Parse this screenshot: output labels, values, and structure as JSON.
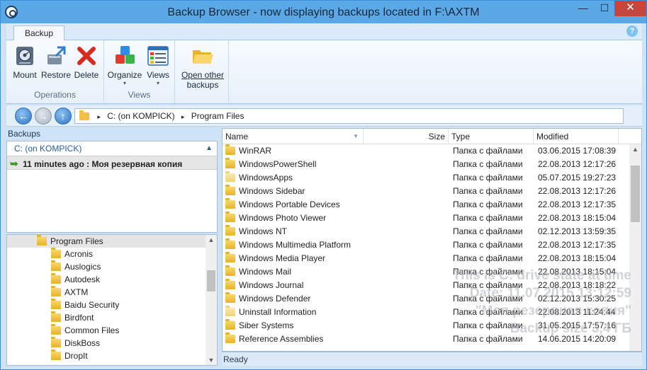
{
  "window": {
    "title": "Backup Browser - now displaying backups located in F:\\AXTM",
    "minimize_glyph": "—",
    "maximize_glyph": "☐",
    "close_glyph": "✕"
  },
  "ribbon": {
    "tab": "Backup",
    "help_glyph": "?",
    "operations": {
      "label": "Operations",
      "buttons": [
        {
          "label": "Mount",
          "icon": "mount-disk-icon"
        },
        {
          "label": "Restore",
          "icon": "restore-icon"
        },
        {
          "label": "Delete",
          "icon": "delete-x-icon"
        }
      ]
    },
    "views": {
      "label": "Views",
      "buttons": [
        {
          "label": "Organize",
          "icon": "organize-cubes-icon"
        },
        {
          "label": "Views",
          "icon": "views-list-icon"
        }
      ]
    },
    "open_other": {
      "label_line1": "Open other",
      "label_line2": "backups",
      "icon": "open-folder-icon"
    }
  },
  "address": {
    "back_glyph": "←",
    "forward_glyph": "→",
    "up_glyph": "↑",
    "separator": "▸",
    "path": [
      "C: (on KOMPICK)",
      "Program Files"
    ]
  },
  "backups": {
    "header": "Backups",
    "drive": "C: (on KOMPICK)",
    "collapse_glyph": "▲",
    "item_icon": "➥",
    "item": "11 minutes ago : Моя резервная копия"
  },
  "tree": {
    "root": "Program Files",
    "scroll_up_glyph": "▲",
    "scroll_down_glyph": "▼",
    "children": [
      "Acronis",
      "Auslogics",
      "Autodesk",
      "AXTM",
      "Baidu Security",
      "Birdfont",
      "Common Files",
      "DiskBoss",
      "DropIt"
    ]
  },
  "list": {
    "columns": {
      "name": "Name",
      "size": "Size",
      "type": "Type",
      "modified": "Modified"
    },
    "sort_glyph": "▼",
    "scroll_up_glyph": "▲",
    "rows": [
      {
        "name": "WinRAR",
        "type": "Папка с файлами",
        "modified": "03.06.2015 17:08:39",
        "pale": false
      },
      {
        "name": "WindowsPowerShell",
        "type": "Папка с файлами",
        "modified": "22.08.2013 12:17:26",
        "pale": false
      },
      {
        "name": "WindowsApps",
        "type": "Папка с файлами",
        "modified": "05.07.2015 19:27:23",
        "pale": true
      },
      {
        "name": "Windows Sidebar",
        "type": "Папка с файлами",
        "modified": "22.08.2013 12:17:26",
        "pale": false
      },
      {
        "name": "Windows Portable Devices",
        "type": "Папка с файлами",
        "modified": "22.08.2013 12:17:35",
        "pale": false
      },
      {
        "name": "Windows Photo Viewer",
        "type": "Папка с файлами",
        "modified": "22.08.2013 18:15:04",
        "pale": false
      },
      {
        "name": "Windows NT",
        "type": "Папка с файлами",
        "modified": "02.12.2013 13:59:35",
        "pale": false
      },
      {
        "name": "Windows Multimedia Platform",
        "type": "Папка с файлами",
        "modified": "22.08.2013 12:17:35",
        "pale": false
      },
      {
        "name": "Windows Media Player",
        "type": "Папка с файлами",
        "modified": "22.08.2013 18:15:04",
        "pale": false
      },
      {
        "name": "Windows Mail",
        "type": "Папка с файлами",
        "modified": "22.08.2013 18:15:04",
        "pale": false
      },
      {
        "name": "Windows Journal",
        "type": "Папка с файлами",
        "modified": "22.08.2013 18:18:22",
        "pale": false
      },
      {
        "name": "Windows Defender",
        "type": "Папка с файлами",
        "modified": "02.12.2013 15:30:25",
        "pale": false
      },
      {
        "name": "Uninstall Information",
        "type": "Папка с файлами",
        "modified": "22.08.2013 11:24:44",
        "pale": true
      },
      {
        "name": "Siber Systems",
        "type": "Папка с файлами",
        "modified": "31.05.2015 17:57:16",
        "pale": false
      },
      {
        "name": "Reference Assemblies",
        "type": "Папка с файлами",
        "modified": "14.06.2015 14:20:09",
        "pale": false
      }
    ]
  },
  "status": "Ready",
  "watermark": [
    "This is C: drive state at time",
    "Date: 11.07.2015 13:12:59",
    "\"Моя резервная копия\"",
    "Backup size 3,4 ГБ"
  ]
}
